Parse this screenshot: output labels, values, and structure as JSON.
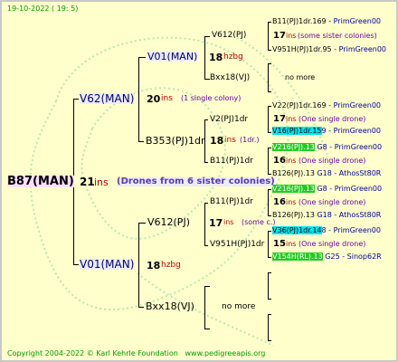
{
  "header": {
    "date": "19-10-2022",
    "time": "( 19: 5)"
  },
  "colors": {
    "background": "#ffffcc",
    "red": "#c00000",
    "purple": "#6a00a8",
    "blue": "#000099",
    "cyan": "#00e5ee",
    "green": "#22cc22"
  },
  "root": {
    "name": "B87(MAN)",
    "ins": "21",
    "ins_label": "ins",
    "note": "(Drones from 6 sister colonies)"
  },
  "g1": {
    "name": "V62(MAN)",
    "ins": "20",
    "ins_label": "ins",
    "note": "(1 single colony)"
  },
  "g2": {
    "name": "V01(MAN)",
    "ins": "18",
    "note": "hzbg"
  },
  "g1a": {
    "name": "V01(MAN)",
    "ins": "18",
    "note": "hzbg"
  },
  "g1a1": {
    "name": "V612(PJ)",
    "ins": "17",
    "ins_label": "ins",
    "note": "(some sister colonies)"
  },
  "g1a2": {
    "name": "Bxx18(VJ)",
    "note": "no more"
  },
  "g1b": {
    "name": "B353(PJ)1dr",
    "ins": "18",
    "ins_label": "ins",
    "note": "(1dr.)"
  },
  "g1b1": {
    "name": "V2(PJ)1dr",
    "ins": "17",
    "ins_label": "ins",
    "note": "(One single drone)"
  },
  "g1b2": {
    "name": "B11(PJ)1dr",
    "ins": "16",
    "ins_label": "ins",
    "note": "(One single drone)"
  },
  "g2a": {
    "name": "V612(PJ)",
    "ins": "17",
    "ins_label": "ins",
    "note": "(some c.)"
  },
  "g2a1": {
    "name": "B11(PJ)1dr",
    "ins": "16",
    "ins_label": "ins",
    "note": "(One single drone)"
  },
  "g2a2": {
    "name": "V951H(PJ)1dr",
    "ins": "15",
    "ins_label": "ins",
    "note": "(One single drone)"
  },
  "g2b": {
    "name": "Bxx18(VJ)",
    "note": "no more"
  },
  "leaves": [
    {
      "text": "B11(PJ)1dr.169",
      "tag": "- PrimGreen00"
    },
    {
      "text": "V951H(PJ)1dr.95",
      "tag": "- PrimGreen00"
    },
    {
      "text": "V22(PJ)1dr.169",
      "tag": "- PrimGreen00"
    },
    {
      "text": "V16(PJ)1dr.15",
      "tag": "9 - PrimGreen00"
    },
    {
      "text": "V216(PJ).13",
      "tag": "G8 - PrimGreen00"
    },
    {
      "text": "B126(PJ).13",
      "tag": "G18 - AthosSt80R"
    },
    {
      "text": "V216(PJ).13",
      "tag": "G8 - PrimGreen00"
    },
    {
      "text": "B126(PJ).13",
      "tag": "G18 - AthosSt80R"
    },
    {
      "text": "V36(PJ)1dr.14",
      "tag": "8 - PrimGreen00"
    },
    {
      "text": "V154H(RL).13",
      "tag": "G25 - Sinop62R"
    }
  ],
  "footer": {
    "copyright": "Copyright 2004-2022 © Karl Kehrle Foundation",
    "site": "www.pedigreeapis.org"
  }
}
